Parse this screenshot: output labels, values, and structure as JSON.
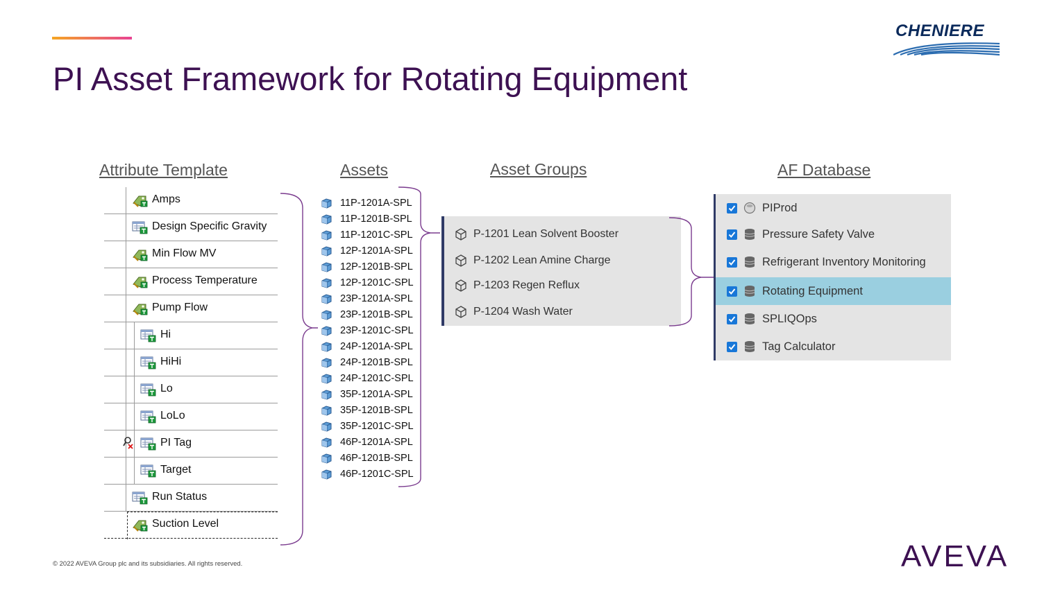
{
  "slide": {
    "title": "PI Asset Framework for Rotating Equipment",
    "footer": "© 2022 AVEVA Group plc and its subsidiaries. All rights reserved.",
    "logo_top": "CHENIERE",
    "logo_bottom": "AVEVA",
    "accent_colors": [
      "#f5a623",
      "#e84393"
    ],
    "title_color": "#3d1152"
  },
  "columns": {
    "attribute_template": "Attribute Template",
    "assets": "Assets",
    "asset_groups": "Asset Groups",
    "af_database": "AF Database"
  },
  "attributes": [
    {
      "label": "Amps",
      "icon": "analysis-icon"
    },
    {
      "label": "Design Specific Gravity",
      "icon": "attribute-table-icon"
    },
    {
      "label": "Min Flow MV",
      "icon": "analysis-icon"
    },
    {
      "label": "Process Temperature",
      "icon": "analysis-icon"
    },
    {
      "label": "Pump Flow",
      "icon": "analysis-icon"
    },
    {
      "label": "Hi",
      "icon": "attribute-table-icon"
    },
    {
      "label": "HiHi",
      "icon": "attribute-table-icon"
    },
    {
      "label": "Lo",
      "icon": "attribute-table-icon"
    },
    {
      "label": "LoLo",
      "icon": "attribute-table-icon"
    },
    {
      "label": "PI Tag",
      "icon": "attribute-table-icon"
    },
    {
      "label": "Target",
      "icon": "attribute-table-icon"
    },
    {
      "label": "Run Status",
      "icon": "attribute-table-icon"
    },
    {
      "label": "Suction Level",
      "icon": "analysis-icon"
    }
  ],
  "assets": [
    "11P-1201A-SPL",
    "11P-1201B-SPL",
    "11P-1201C-SPL",
    "12P-1201A-SPL",
    "12P-1201B-SPL",
    "12P-1201C-SPL",
    "23P-1201A-SPL",
    "23P-1201B-SPL",
    "23P-1201C-SPL",
    "24P-1201A-SPL",
    "24P-1201B-SPL",
    "24P-1201C-SPL",
    "35P-1201A-SPL",
    "35P-1201B-SPL",
    "35P-1201C-SPL",
    "46P-1201A-SPL",
    "46P-1201B-SPL",
    "46P-1201C-SPL"
  ],
  "asset_groups": [
    "P-1201 Lean Solvent Booster",
    "P-1202 Lean Amine Charge",
    "P-1203 Regen Reflux",
    "P-1204 Wash Water"
  ],
  "af_databases": [
    {
      "label": "PIProd",
      "checked": true,
      "selected": false
    },
    {
      "label": "Pressure Safety Valve",
      "checked": true,
      "selected": false
    },
    {
      "label": "Refrigerant Inventory Monitoring",
      "checked": true,
      "selected": false
    },
    {
      "label": "Rotating Equipment",
      "checked": true,
      "selected": true
    },
    {
      "label": "SPLIQOps",
      "checked": true,
      "selected": false
    },
    {
      "label": "Tag Calculator",
      "checked": true,
      "selected": false
    }
  ]
}
